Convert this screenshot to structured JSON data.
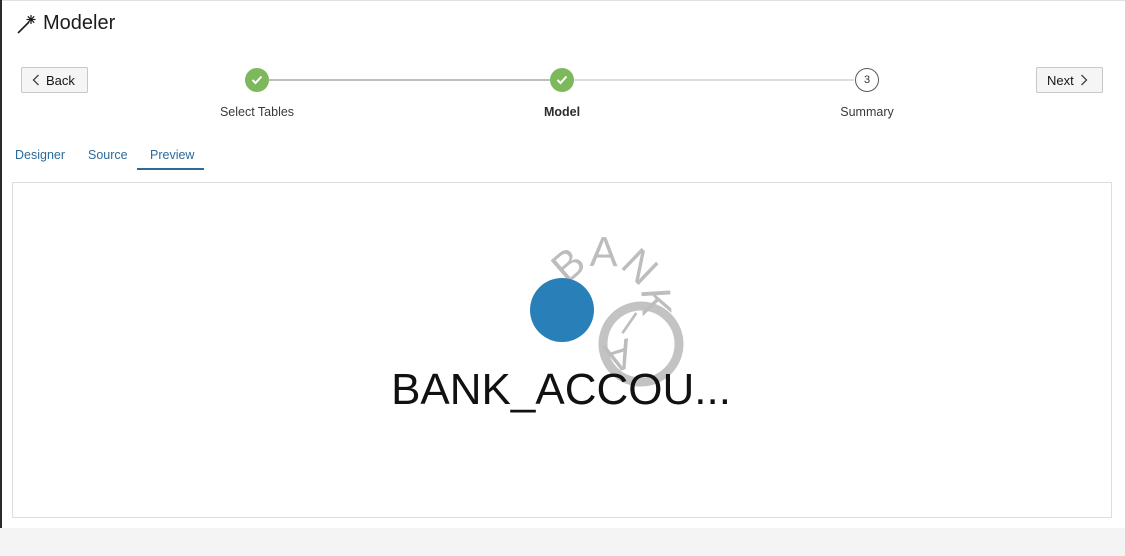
{
  "header": {
    "title": "Modeler",
    "icon": "magic-wand-icon"
  },
  "nav": {
    "back_label": "Back",
    "next_label": "Next"
  },
  "train": {
    "steps": [
      {
        "label": "Select Tables",
        "state": "complete"
      },
      {
        "label": "Model",
        "state": "current-complete"
      },
      {
        "label": "Summary",
        "state": "pending",
        "number": "3"
      }
    ],
    "complete_color": "#7eb85c"
  },
  "tabs": [
    {
      "label": "Designer"
    },
    {
      "label": "Source"
    },
    {
      "label": "Preview",
      "selected": true
    }
  ],
  "preview": {
    "node_label": "BANK_ACCOU...",
    "curved_label": "BANK_ACCOUNTS",
    "node_color": "#2980b9",
    "ring_color": "#c3c3c3"
  }
}
